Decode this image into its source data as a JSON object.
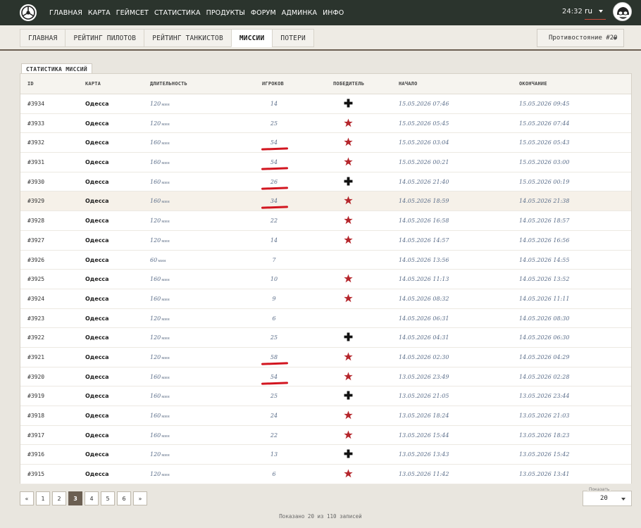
{
  "topnav": {
    "items": [
      "ГЛАВНАЯ",
      "КАРТА",
      "ГЕЙМСЕТ",
      "СТАТИСТИКА",
      "ПРОДУКТЫ",
      "ФОРУМ",
      "АДМИНКА",
      "ИНФО"
    ],
    "time": "24:32",
    "language": "ru"
  },
  "tabs": {
    "items": [
      "ГЛАВНАЯ",
      "РЕЙТИНГ ПИЛОТОВ",
      "РЕЙТИНГ ТАНКИСТОВ",
      "МИССИИ",
      "ПОТЕРИ"
    ],
    "active_index": 3,
    "season_select": "Противостояние #20"
  },
  "panel": {
    "title": "СТАТИСТИКА МИССИЙ",
    "columns": [
      "ID",
      "КАРТА",
      "ДЛИТЕЛЬНОСТЬ",
      "ИГРОКОВ",
      "ПОБЕДИТЕЛЬ",
      "НАЧАЛО",
      "ОКОНЧАНИЕ"
    ],
    "duration_unit": "мин"
  },
  "rows": [
    {
      "id": "#3934",
      "map": "Одесса",
      "duration": "120",
      "players": "14",
      "winner": "cross",
      "start": "15.05.2026 07:46",
      "end": "15.05.2026 09:45",
      "marked": false
    },
    {
      "id": "#3933",
      "map": "Одесса",
      "duration": "120",
      "players": "25",
      "winner": "star",
      "start": "15.05.2026 05:45",
      "end": "15.05.2026 07:44",
      "marked": false
    },
    {
      "id": "#3932",
      "map": "Одесса",
      "duration": "160",
      "players": "54",
      "winner": "star",
      "start": "15.05.2026 03:04",
      "end": "15.05.2026 05:43",
      "marked": true
    },
    {
      "id": "#3931",
      "map": "Одесса",
      "duration": "160",
      "players": "54",
      "winner": "star",
      "start": "15.05.2026 00:21",
      "end": "15.05.2026 03:00",
      "marked": true
    },
    {
      "id": "#3930",
      "map": "Одесса",
      "duration": "160",
      "players": "26",
      "winner": "cross",
      "start": "14.05.2026 21:40",
      "end": "15.05.2026 00:19",
      "marked": true
    },
    {
      "id": "#3929",
      "map": "Одесса",
      "duration": "160",
      "players": "34",
      "winner": "star",
      "start": "14.05.2026 18:59",
      "end": "14.05.2026 21:38",
      "marked": true,
      "highlight": true
    },
    {
      "id": "#3928",
      "map": "Одесса",
      "duration": "120",
      "players": "22",
      "winner": "star",
      "start": "14.05.2026 16:58",
      "end": "14.05.2026 18:57",
      "marked": false
    },
    {
      "id": "#3927",
      "map": "Одесса",
      "duration": "120",
      "players": "14",
      "winner": "star",
      "start": "14.05.2026 14:57",
      "end": "14.05.2026 16:56",
      "marked": false
    },
    {
      "id": "#3926",
      "map": "Одесса",
      "duration": "60",
      "players": "7",
      "winner": "",
      "start": "14.05.2026 13:56",
      "end": "14.05.2026 14:55",
      "marked": false
    },
    {
      "id": "#3925",
      "map": "Одесса",
      "duration": "160",
      "players": "10",
      "winner": "star",
      "start": "14.05.2026 11:13",
      "end": "14.05.2026 13:52",
      "marked": false
    },
    {
      "id": "#3924",
      "map": "Одесса",
      "duration": "160",
      "players": "9",
      "winner": "star",
      "start": "14.05.2026 08:32",
      "end": "14.05.2026 11:11",
      "marked": false
    },
    {
      "id": "#3923",
      "map": "Одесса",
      "duration": "120",
      "players": "6",
      "winner": "",
      "start": "14.05.2026 06:31",
      "end": "14.05.2026 08:30",
      "marked": false
    },
    {
      "id": "#3922",
      "map": "Одесса",
      "duration": "120",
      "players": "25",
      "winner": "cross",
      "start": "14.05.2026 04:31",
      "end": "14.05.2026 06:30",
      "marked": false
    },
    {
      "id": "#3921",
      "map": "Одесса",
      "duration": "120",
      "players": "58",
      "winner": "star",
      "start": "14.05.2026 02:30",
      "end": "14.05.2026 04:29",
      "marked": true
    },
    {
      "id": "#3920",
      "map": "Одесса",
      "duration": "160",
      "players": "54",
      "winner": "star",
      "start": "13.05.2026 23:49",
      "end": "14.05.2026 02:28",
      "marked": true
    },
    {
      "id": "#3919",
      "map": "Одесса",
      "duration": "160",
      "players": "25",
      "winner": "cross",
      "start": "13.05.2026 21:05",
      "end": "13.05.2026 23:44",
      "marked": false
    },
    {
      "id": "#3918",
      "map": "Одесса",
      "duration": "160",
      "players": "24",
      "winner": "star",
      "start": "13.05.2026 18:24",
      "end": "13.05.2026 21:03",
      "marked": false
    },
    {
      "id": "#3917",
      "map": "Одесса",
      "duration": "160",
      "players": "22",
      "winner": "star",
      "start": "13.05.2026 15:44",
      "end": "13.05.2026 18:23",
      "marked": false
    },
    {
      "id": "#3916",
      "map": "Одесса",
      "duration": "120",
      "players": "13",
      "winner": "cross",
      "start": "13.05.2026 13:43",
      "end": "13.05.2026 15:42",
      "marked": false
    },
    {
      "id": "#3915",
      "map": "Одесса",
      "duration": "120",
      "players": "6",
      "winner": "star",
      "start": "13.05.2026 11:42",
      "end": "13.05.2026 13:41",
      "marked": false
    }
  ],
  "pagination": {
    "first": "«",
    "last": "»",
    "pages": [
      "1",
      "2",
      "3",
      "4",
      "5",
      "6"
    ],
    "current": "3",
    "show_label": "Показать",
    "per_page": "20"
  },
  "footer": "Показано 20 из 110 записей",
  "colors": {
    "topbar": "#2b342d",
    "star": "#b5262c",
    "cross": "#111111",
    "active_page": "#6b5f52",
    "underline_marks": "#d2151f"
  }
}
